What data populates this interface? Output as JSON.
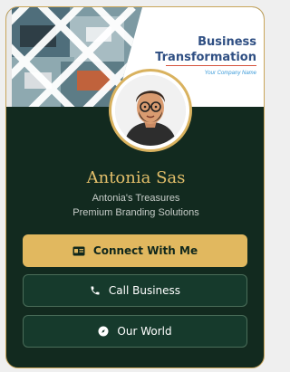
{
  "banner": {
    "title_line1": "Business",
    "title_line2": "Transformation",
    "company": "Your Company Name"
  },
  "profile": {
    "name": "Antonia Sas",
    "line1": "Antonia's Treasures",
    "line2": "Premium Branding Solutions"
  },
  "buttons": {
    "connect": "Connect With Me",
    "call": "Call Business",
    "world": "Our World"
  },
  "colors": {
    "card_bg": "#122a1f",
    "accent_gold": "#e1b85f",
    "button_outline_bg": "#163a2c",
    "banner_title": "#2f4f83"
  },
  "icons": {
    "connect": "id-card-icon",
    "call": "phone-icon",
    "world": "compass-icon"
  }
}
